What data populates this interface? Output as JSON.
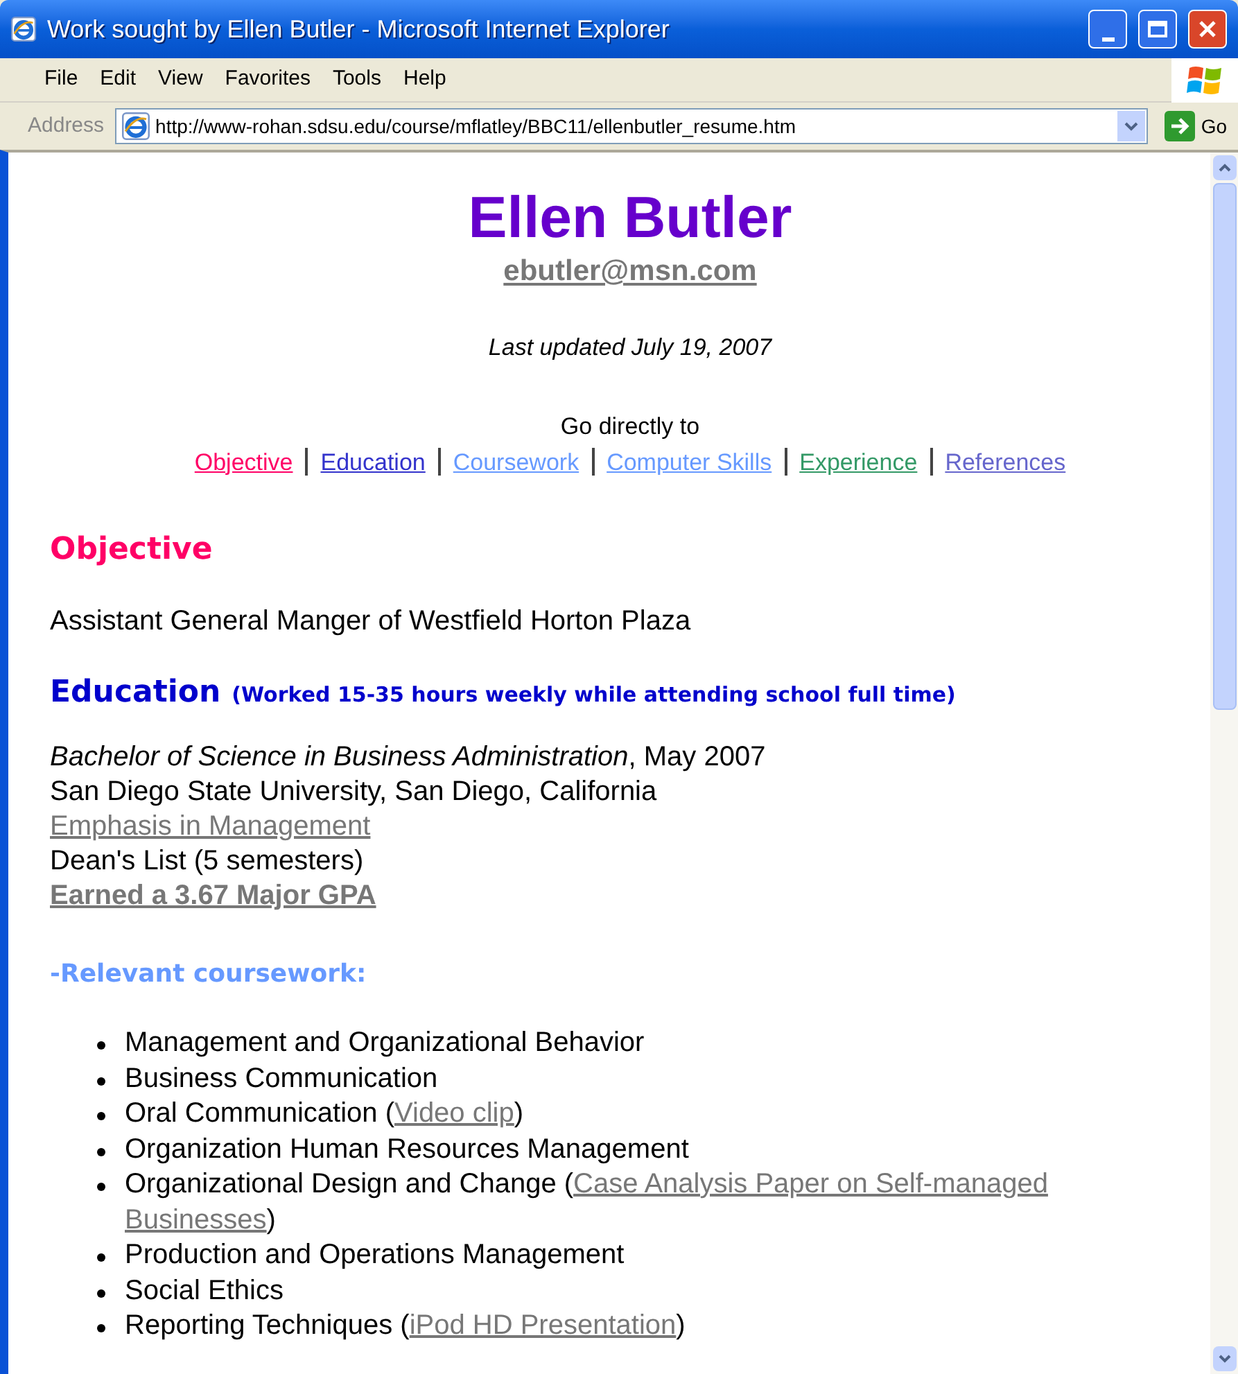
{
  "window": {
    "title": "Work sought by Ellen Butler - Microsoft Internet Explorer"
  },
  "menu": [
    "File",
    "Edit",
    "View",
    "Favorites",
    "Tools",
    "Help"
  ],
  "address": {
    "label": "Address",
    "url": "http://www-rohan.sdsu.edu/course/mflatley/BBC11/ellenbutler_resume.htm",
    "go": "Go"
  },
  "page": {
    "name": "Ellen Butler",
    "email": "ebutler@msn.com",
    "updated": "Last updated July 19, 2007",
    "nav_label": "Go directly to",
    "nav": [
      {
        "label": "Objective",
        "color": "#ff0066"
      },
      {
        "label": "Education",
        "color": "#3333cc"
      },
      {
        "label": "Coursework",
        "color": "#6699ff"
      },
      {
        "label": "Computer Skills",
        "color": "#6699ff"
      },
      {
        "label": "Experience",
        "color": "#339966"
      },
      {
        "label": "References",
        "color": "#6666cc"
      }
    ],
    "objective": {
      "heading": "Objective",
      "text": "Assistant General Manger of Westfield Horton Plaza"
    },
    "education": {
      "heading": "Education",
      "note": "(Worked 15-35 hours weekly while attending school full time)",
      "lines": [
        {
          "kind": "text",
          "text": "*Bachelor of Science in Business Administration*, May 2007"
        },
        {
          "kind": "text",
          "text": "San Diego State University, San Diego, California"
        },
        {
          "kind": "link",
          "text": "Emphasis in Management"
        },
        {
          "kind": "text",
          "text": "Dean's List (5 semesters)"
        },
        {
          "kind": "bold-link",
          "text": "Earned a 3.67 Major GPA"
        }
      ]
    },
    "coursework": {
      "heading": "-Relevant coursework:",
      "items": [
        {
          "text": "Management and Organizational Behavior"
        },
        {
          "text": "Business Communication"
        },
        {
          "text": "Oral Communication (",
          "link": [
            "Video clip"
          ],
          "after": ")"
        },
        {
          "text": "Organization Human Resources Management"
        },
        {
          "text": "Organizational Design and Change (",
          "link": [
            "Case Analysis Paper on Self-managed",
            "Businesses"
          ],
          "after": ")"
        },
        {
          "text": "Production and Operations Management"
        },
        {
          "text": "Social Ethics"
        },
        {
          "text": "Reporting Techniques (",
          "link": [
            "iPod HD Presentation"
          ],
          "after": ")"
        }
      ]
    }
  }
}
